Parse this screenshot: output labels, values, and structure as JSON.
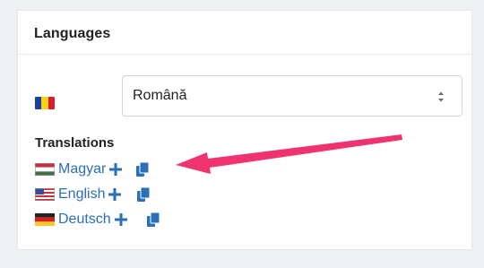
{
  "panel": {
    "title": "Languages"
  },
  "language_select": {
    "selected": "Română",
    "flag": "romania-flag-icon"
  },
  "translations": {
    "title": "Translations",
    "items": [
      {
        "label": "Magyar",
        "flag": "hungary-flag-icon"
      },
      {
        "label": "English",
        "flag": "usa-flag-icon"
      },
      {
        "label": "Deutsch",
        "flag": "germany-flag-icon"
      }
    ]
  },
  "colors": {
    "link": "#2a6fb8",
    "icon": "#2a6fb8",
    "arrow": "#f0336f"
  }
}
